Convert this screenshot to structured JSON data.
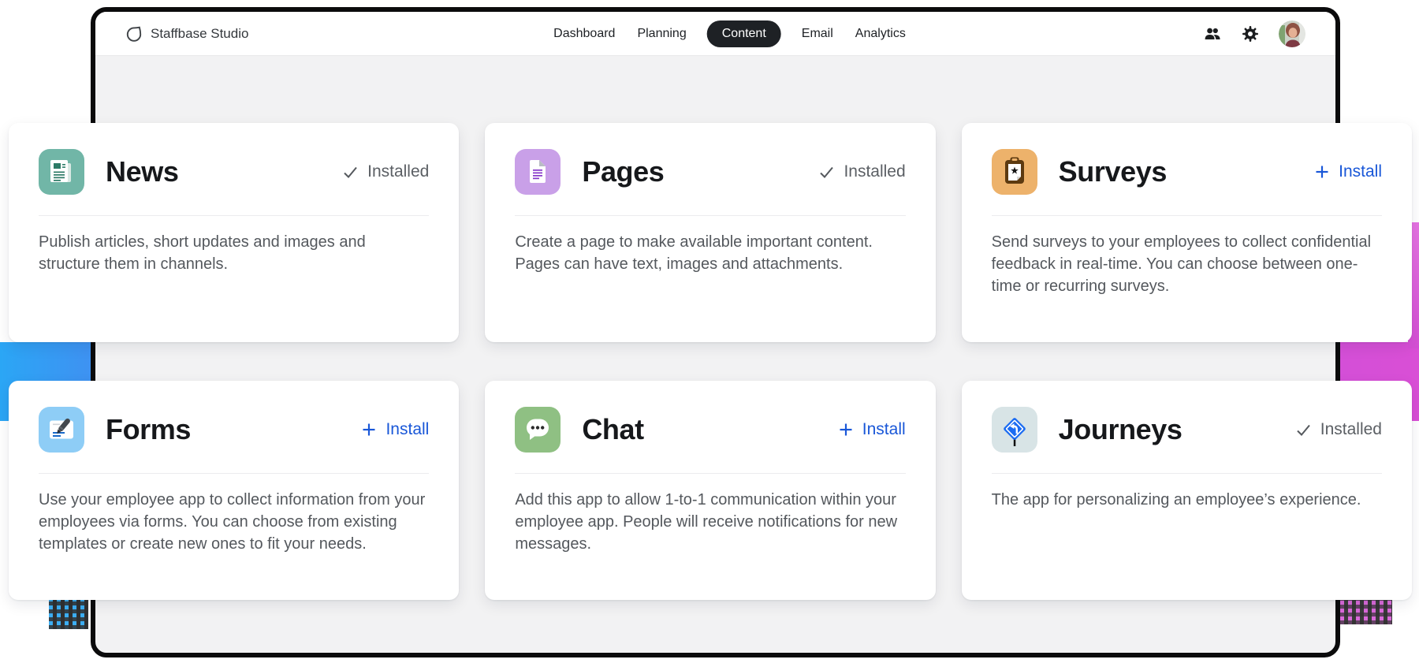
{
  "app": {
    "brand": "Staffbase Studio"
  },
  "navbar": {
    "tabs": [
      {
        "label": "Dashboard",
        "active": false
      },
      {
        "label": "Planning",
        "active": false
      },
      {
        "label": "Content",
        "active": true
      },
      {
        "label": "Email",
        "active": false
      },
      {
        "label": "Analytics",
        "active": false
      }
    ]
  },
  "cards": [
    {
      "title": "News",
      "status": "Installed",
      "installed": true,
      "icon": "newspaper-icon",
      "icon_bg": "#71B6A7",
      "description": "Publish articles, short updates and images and structure them in channels."
    },
    {
      "title": "Pages",
      "status": "Installed",
      "installed": true,
      "icon": "document-icon",
      "icon_bg": "#C9A0E8",
      "description": "Create a page to make available important content. Pages can have text, images and attachments."
    },
    {
      "title": "Surveys",
      "status": "Install",
      "installed": false,
      "icon": "clipboard-star-icon",
      "icon_bg": "#EDB26B",
      "description": "Send surveys to your employees to collect confidential feedback in real-time. You can choose between one-time or recurring surveys."
    },
    {
      "title": "Forms",
      "status": "Install",
      "installed": false,
      "icon": "form-pen-icon",
      "icon_bg": "#8ECDF6",
      "description": "Use your employee app to collect information from your employees via forms. You can choose from existing templates or create new ones to fit your needs."
    },
    {
      "title": "Chat",
      "status": "Install",
      "installed": false,
      "icon": "chat-bubble-icon",
      "icon_bg": "#8FC083",
      "description": "Add this app to allow 1-to-1 communication within your employee app. People will receive notifications for new messages."
    },
    {
      "title": "Journeys",
      "status": "Installed",
      "installed": true,
      "icon": "road-sign-icon",
      "icon_bg": "#D8E4E6",
      "description": "The app for personalizing an employee’s experience."
    }
  ],
  "colors": {
    "accent_blue": "#1957D8",
    "installed_gray": "#5B5F64",
    "active_tab_bg": "#1E2125",
    "content_bg": "#F2F2F3",
    "backdrop_left": "#2BA6F5",
    "backdrop_right": "#D94FD6"
  }
}
